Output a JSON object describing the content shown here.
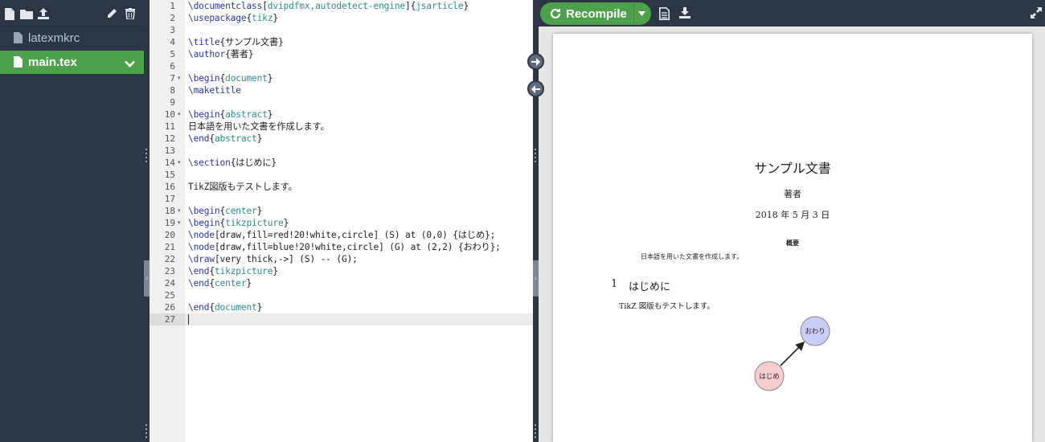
{
  "sidebar": {
    "files": [
      {
        "name": "latexmkrc",
        "icon": "file-icon"
      },
      {
        "name": "main.tex",
        "icon": "file-icon",
        "selected": true
      }
    ]
  },
  "editor": {
    "lines": [
      {
        "n": "1",
        "fold": "",
        "segs": [
          [
            "c",
            "\\documentclass"
          ],
          [
            "p",
            "["
          ],
          [
            "a",
            "dvipdfmx,autodetect-engine"
          ],
          [
            "p",
            "]{"
          ],
          [
            "a",
            "jsarticle"
          ],
          [
            "p",
            "}"
          ]
        ]
      },
      {
        "n": "2",
        "fold": "",
        "segs": [
          [
            "c",
            "\\usepackage"
          ],
          [
            "p",
            "{"
          ],
          [
            "a",
            "tikz"
          ],
          [
            "p",
            "}"
          ]
        ]
      },
      {
        "n": "3",
        "fold": "",
        "segs": []
      },
      {
        "n": "4",
        "fold": "",
        "segs": [
          [
            "c",
            "\\title"
          ],
          [
            "p",
            "{サンプル文書}"
          ]
        ]
      },
      {
        "n": "5",
        "fold": "",
        "segs": [
          [
            "c",
            "\\author"
          ],
          [
            "p",
            "{著者}"
          ]
        ]
      },
      {
        "n": "6",
        "fold": "",
        "segs": []
      },
      {
        "n": "7",
        "fold": "▾",
        "segs": [
          [
            "c",
            "\\begin"
          ],
          [
            "p",
            "{"
          ],
          [
            "a",
            "document"
          ],
          [
            "p",
            "}"
          ]
        ]
      },
      {
        "n": "8",
        "fold": "",
        "segs": [
          [
            "c",
            "\\maketitle"
          ]
        ]
      },
      {
        "n": "9",
        "fold": "",
        "segs": []
      },
      {
        "n": "10",
        "fold": "▾",
        "segs": [
          [
            "c",
            "\\begin"
          ],
          [
            "p",
            "{"
          ],
          [
            "a",
            "abstract"
          ],
          [
            "p",
            "}"
          ]
        ]
      },
      {
        "n": "11",
        "fold": "",
        "segs": [
          [
            "p",
            "日本語を用いた文書を作成します。"
          ]
        ]
      },
      {
        "n": "12",
        "fold": "",
        "segs": [
          [
            "c",
            "\\end"
          ],
          [
            "p",
            "{"
          ],
          [
            "a",
            "abstract"
          ],
          [
            "p",
            "}"
          ]
        ]
      },
      {
        "n": "13",
        "fold": "",
        "segs": []
      },
      {
        "n": "14",
        "fold": "▾",
        "segs": [
          [
            "c",
            "\\section"
          ],
          [
            "p",
            "{はじめに}"
          ]
        ]
      },
      {
        "n": "15",
        "fold": "",
        "segs": []
      },
      {
        "n": "16",
        "fold": "",
        "segs": [
          [
            "p",
            "TikZ図版もテストします。"
          ]
        ]
      },
      {
        "n": "17",
        "fold": "",
        "segs": []
      },
      {
        "n": "18",
        "fold": "▾",
        "segs": [
          [
            "c",
            "\\begin"
          ],
          [
            "p",
            "{"
          ],
          [
            "a",
            "center"
          ],
          [
            "p",
            "}"
          ]
        ]
      },
      {
        "n": "19",
        "fold": "▾",
        "segs": [
          [
            "c",
            "\\begin"
          ],
          [
            "p",
            "{"
          ],
          [
            "a",
            "tikzpicture"
          ],
          [
            "p",
            "}"
          ]
        ]
      },
      {
        "n": "20",
        "fold": "",
        "segs": [
          [
            "c",
            "\\node"
          ],
          [
            "p",
            "[draw,fill=red!20!white,circle] (S) at (0,0) {はじめ};"
          ]
        ]
      },
      {
        "n": "21",
        "fold": "",
        "segs": [
          [
            "c",
            "\\node"
          ],
          [
            "p",
            "[draw,fill=blue!20!white,circle] (G) at (2,2) {おわり};"
          ]
        ]
      },
      {
        "n": "22",
        "fold": "",
        "segs": [
          [
            "c",
            "\\draw"
          ],
          [
            "p",
            "[very thick,->] (S) -- (G);"
          ]
        ]
      },
      {
        "n": "23",
        "fold": "",
        "segs": [
          [
            "c",
            "\\end"
          ],
          [
            "p",
            "{"
          ],
          [
            "a",
            "tikzpicture"
          ],
          [
            "p",
            "}"
          ]
        ]
      },
      {
        "n": "24",
        "fold": "",
        "segs": [
          [
            "c",
            "\\end"
          ],
          [
            "p",
            "{"
          ],
          [
            "a",
            "center"
          ],
          [
            "p",
            "}"
          ]
        ]
      },
      {
        "n": "25",
        "fold": "",
        "segs": []
      },
      {
        "n": "26",
        "fold": "",
        "segs": [
          [
            "c",
            "\\end"
          ],
          [
            "p",
            "{"
          ],
          [
            "a",
            "document"
          ],
          [
            "p",
            "}"
          ]
        ]
      },
      {
        "n": "27",
        "fold": "",
        "segs": []
      }
    ]
  },
  "pdf": {
    "toolbar": {
      "recompile_label": "Recompile"
    },
    "title": "サンプル文書",
    "author": "著者",
    "date": "2018 年 5 月 3 日",
    "abstract_heading": "概要",
    "abstract_text": "日本語を用いた文書を作成します。",
    "section_number": "1",
    "section_title": "はじめに",
    "body_text": "TikZ 図版もテストします。",
    "figure": {
      "start_node": {
        "label": "はじめ",
        "fill": "#f8cccc"
      },
      "end_node": {
        "label": "おわり",
        "fill": "#ccccf8"
      }
    }
  },
  "colors": {
    "accent_green": "#4ea14c",
    "sidebar_bg": "#2c3645",
    "command_blue": "#2f34a8",
    "argument_teal": "#2c8c8c"
  }
}
